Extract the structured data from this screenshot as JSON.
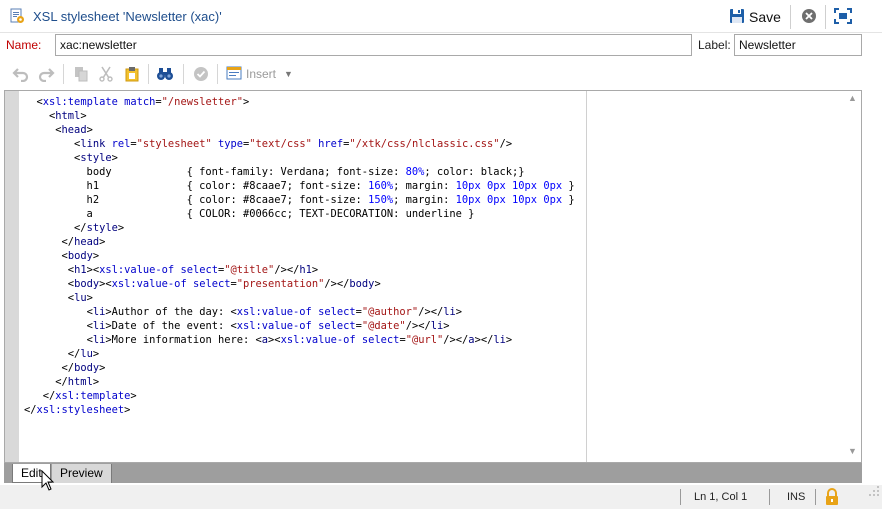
{
  "window": {
    "title": "XSL stylesheet 'Newsletter (xac)'",
    "save_label": "Save"
  },
  "fields": {
    "name_label": "Name:",
    "name_value": "xac:newsletter",
    "label_label": "Label:",
    "label_value": "Newsletter"
  },
  "toolbar": {
    "insert_label": "Insert",
    "icons": [
      "undo-icon",
      "redo-icon",
      "copy-icon",
      "cut-icon",
      "paste-icon",
      "find-icon",
      "validate-icon",
      "insert-icon",
      "dropdown-icon"
    ]
  },
  "editor": {
    "lines": [
      "  <xsl:template match=\"/newsletter\">",
      "    <html>",
      "     <head>",
      "        <link rel=\"stylesheet\" type=\"text/css\" href=\"/xtk/css/nlclassic.css\"/>",
      "        <style>",
      "          body            { font-family: Verdana; font-size: 80%; color: black;}",
      "          h1              { color: #8caae7; font-size: 160%; margin: 10px 0px 10px 0px }",
      "          h2              { color: #8caae7; font-size: 150%; margin: 10px 0px 10px 0px }",
      "          a               { COLOR: #0066cc; TEXT-DECORATION: underline }",
      "        </style>",
      "      </head>",
      "      <body>",
      "       <h1><xsl:value-of select=\"@title\"/></h1>",
      "       <body><xsl:value-of select=\"presentation\"/></body>",
      "       <lu>",
      "          <li>Author of the day: <xsl:value-of select=\"@author\"/></li>",
      "          <li>Date of the event: <xsl:value-of select=\"@date\"/></li>",
      "          <li>More information here: <a><xsl:value-of select=\"@url\"/></a></li>",
      "       </lu>",
      "      </body>",
      "     </html>",
      "   </xsl:template>",
      "</xsl:stylesheet>"
    ]
  },
  "tabs": [
    {
      "label": "Edit",
      "active": true
    },
    {
      "label": "Preview",
      "active": false
    }
  ],
  "status": {
    "position": "Ln 1, Col 1",
    "mode": "INS"
  },
  "colors": {
    "title_text": "#1f4e8c",
    "required_label": "#c00000",
    "save_icon": "#1e5fa8",
    "lock_icon": "#e8a317"
  }
}
